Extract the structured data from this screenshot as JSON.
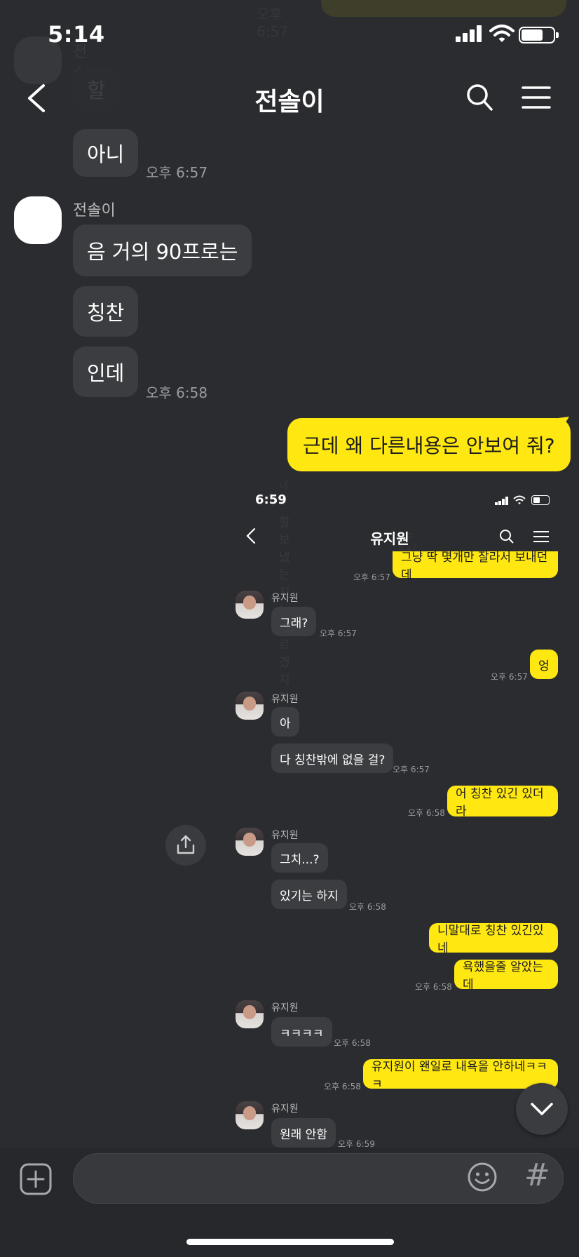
{
  "status": {
    "time": "5:14"
  },
  "header": {
    "title": "전솔이"
  },
  "faded": {
    "top_time": "오후 6:57",
    "sender": "전솔이",
    "bubble": "할",
    "e_label1": "내용",
    "e_label2": "할 보냈는지는 모르겠지만",
    "e_ts": "오후 6:57"
  },
  "messages": {
    "m1": {
      "text": "아니",
      "time": "오후 6:57"
    },
    "group2": {
      "sender": "전솔이",
      "b1": "음 거의 90프로는",
      "b2": "칭찬",
      "b3": "인데",
      "time": "오후 6:58"
    },
    "out1": {
      "text": "근데 왜 다른내용은 안보여 줘?"
    }
  },
  "embedded": {
    "status_time": "6:59",
    "title": "유지원",
    "msgs": {
      "o1": {
        "text": "그냥 딱 몇개만 잘라서 보내던데",
        "time": "오후 6:57"
      },
      "g1": {
        "name": "유지원",
        "b1": "그래?",
        "time": "오후 6:57"
      },
      "o2": {
        "text": "엉",
        "time": "오후 6:57"
      },
      "g2": {
        "name": "유지원",
        "b1": "아",
        "b2": "다 칭찬밖에 없을 걸?",
        "time": "오후 6:57"
      },
      "o3": {
        "text": "어 칭찬 있긴 있더라",
        "time": "오후 6:58"
      },
      "g3": {
        "name": "유지원",
        "b1": "그치...?",
        "b2": "있기는 하지",
        "time": "오후 6:58"
      },
      "o4": {
        "text": "니말대로 칭찬 있긴있네",
        "text2": "욕했을줄 알았는데",
        "time": "오후 6:58"
      },
      "g4": {
        "name": "유지원",
        "b1": "ㅋㅋㅋㅋ",
        "time": "오후 6:58"
      },
      "o5": {
        "text": "유지원이 왠일로 내욕을 안하네ㅋㅋㅋ",
        "time": "오후 6:58"
      },
      "g5": {
        "name": "유지원",
        "b1": "원래 안함",
        "time": "오후 6:59"
      }
    }
  },
  "input": {
    "hash": "#"
  },
  "colors": {
    "background": "#2b2c2f",
    "bubble_in": "#3c3d40",
    "bubble_out": "#ffe812"
  },
  "icons": [
    "back-icon",
    "search-icon",
    "menu-icon",
    "share-icon",
    "chevron-down-icon",
    "plus-icon",
    "emoji-icon",
    "hash-icon"
  ]
}
